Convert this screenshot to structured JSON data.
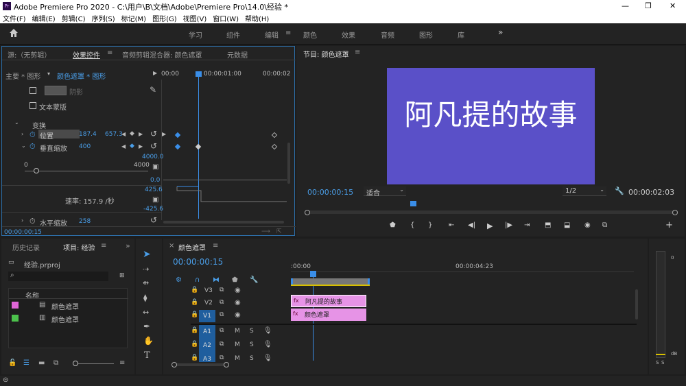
{
  "titlebar": {
    "app_icon": "Pr",
    "title": "Adobe Premiere Pro 2020 - C:\\用户\\B\\文档\\Adobe\\Premiere Pro\\14.0\\经验 *",
    "min": "—",
    "max": "❐",
    "close": "✕"
  },
  "menu": [
    "文件(F)",
    "编辑(E)",
    "剪辑(C)",
    "序列(S)",
    "标记(M)",
    "图形(G)",
    "视图(V)",
    "窗口(W)",
    "帮助(H)"
  ],
  "workspaces": [
    "学习",
    "组件",
    "编辑",
    "颜色",
    "效果",
    "音频",
    "图形",
    "库"
  ],
  "workspace_active": "编辑",
  "workspace_more": "»",
  "source_panel": {
    "tabs": [
      "源:（无剪辑）",
      "效果控件",
      "音频剪辑混合器: 颜色遮罩",
      "元数据"
    ],
    "header_master": "主要 * 图形",
    "header_clip": "颜色遮罩 * 图形",
    "ruler": [
      "00:00",
      "00:00:01:00",
      "00:00:02"
    ],
    "shadow_label": "阴影",
    "text_mask_label": "文本蒙版",
    "transform_label": "变换",
    "position_label": "位置",
    "position_x": "187.4",
    "position_y": "657.3",
    "vscale_label": "垂直缩放",
    "vscale_value": "400",
    "slider_min": "0",
    "slider_max": "4000",
    "graph_top": "4000.0",
    "graph_mid": "0.0",
    "graph_val": "425.6",
    "graph_neg": "-425.6",
    "rate": "速率: 157.9 /秒",
    "hscale_label": "水平缩放",
    "hscale_value": "258",
    "timecode": "00:00:00:15"
  },
  "program": {
    "title": "节目: 颜色遮罩",
    "video_text": "阿凡提的故事",
    "video_bg": "#5a50c8",
    "timecode": "00:00:00:15",
    "fit": "适合",
    "res": "1/2",
    "duration": "00:00:02:03"
  },
  "project": {
    "tabs": [
      "历史记录",
      "项目: 经验"
    ],
    "file": "经验.prproj",
    "col_name": "名称",
    "items": [
      {
        "name": "颜色遮罩",
        "color": "#e066d8"
      },
      {
        "name": "颜色遮罩",
        "color": "#4cc24c"
      }
    ]
  },
  "timeline": {
    "tab": "颜色遮罩",
    "timecode": "00:00:00:15",
    "ruler": [
      ":00:00",
      "00:00:04:23"
    ],
    "tracks_v": [
      "V3",
      "V2",
      "V1"
    ],
    "tracks_a": [
      "A1",
      "A2",
      "A3"
    ],
    "clip_v2": "阿凡提的故事",
    "clip_v1": "颜色遮罩",
    "fx": "fx",
    "m": "M",
    "s": "S"
  },
  "meter": {
    "top": "0",
    "bottom": "dB",
    "s1": "S",
    "s2": "S"
  }
}
